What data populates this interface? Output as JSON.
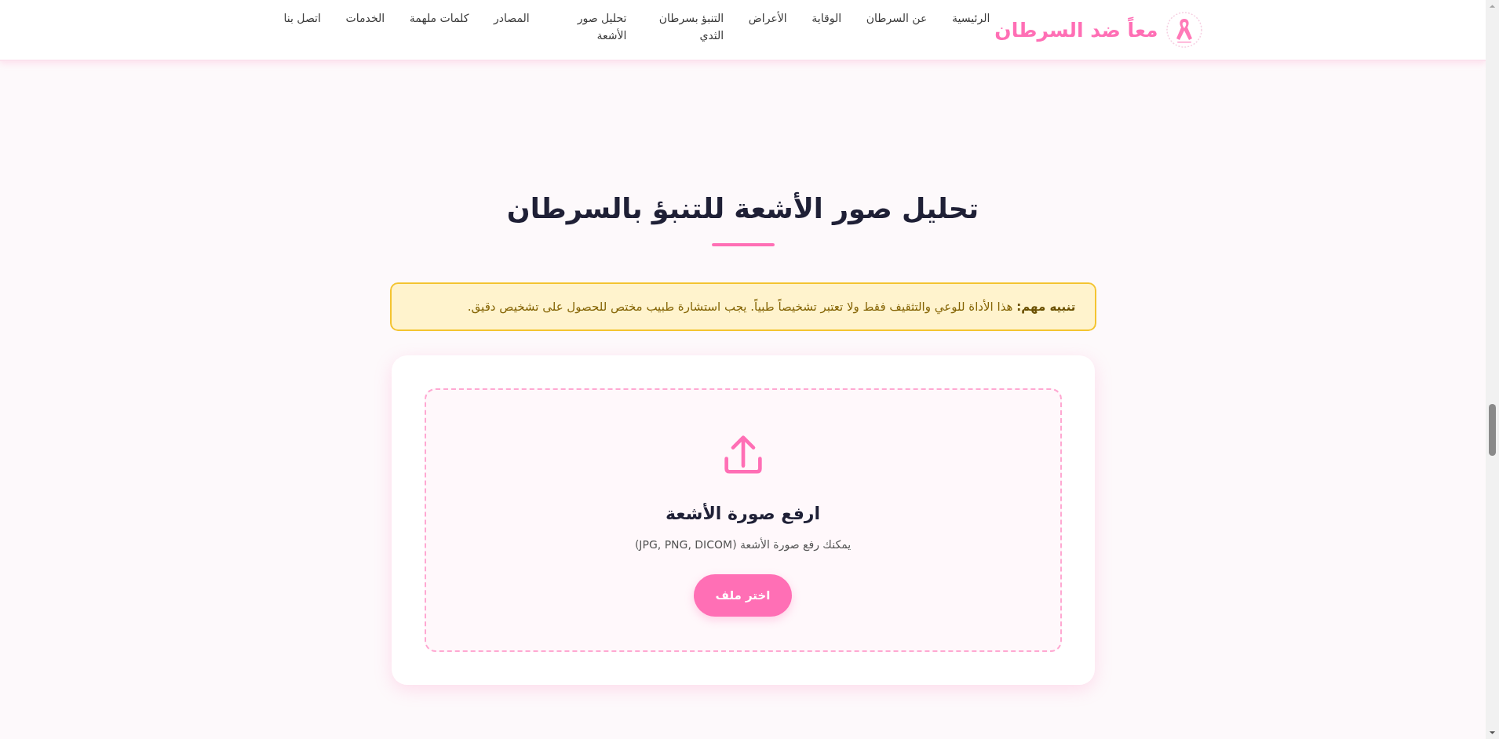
{
  "nav": {
    "brand": "معاً ضد السرطان",
    "items": [
      {
        "label": "الرئيسية"
      },
      {
        "label": "عن السرطان"
      },
      {
        "label": "الوقاية"
      },
      {
        "label": "الأعراض"
      },
      {
        "label": "التنبؤ بسرطان الثدي"
      },
      {
        "label": "تحليل صور الأشعة"
      },
      {
        "label": "المصادر"
      },
      {
        "label": "كلمات ملهمة"
      },
      {
        "label": "الخدمات"
      },
      {
        "label": "اتصل بنا"
      }
    ]
  },
  "section": {
    "title": "تحليل صور الأشعة للتنبؤ بالسرطان",
    "notice": "**تنبيه مهم:** هذا الأداة للوعي والتثقيف فقط ولا تعتبر تشخيصاً طبياً. يجب استشارة طبيب مختص للحصول على تشخيص دقيق."
  },
  "upload": {
    "heading": "ارفع صورة الأشعة",
    "hint": "يمكنك رفع صورة الأشعة (JPG, PNG, DICOM)",
    "button": "اختر ملف"
  }
}
